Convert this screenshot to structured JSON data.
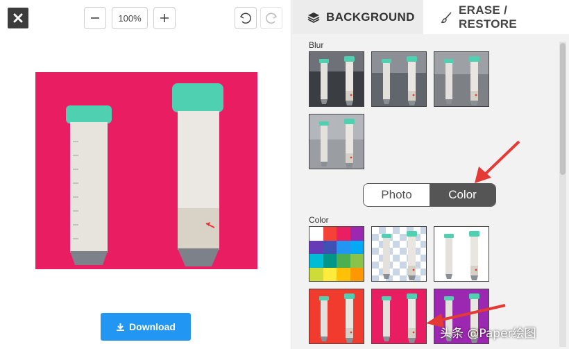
{
  "toolbar": {
    "zoom": "100%"
  },
  "download_label": "Download",
  "tabs": {
    "background": "BACKGROUND",
    "erase_restore": "ERASE / RESTORE"
  },
  "blur_label": "Blur",
  "toggle": {
    "photo": "Photo",
    "color": "Color"
  },
  "color_label": "Color",
  "watermark": "头条 @Paper绘图",
  "colors": {
    "canvas_bg": "#e91e62",
    "download": "#2196f3",
    "cap": "#4fd0b0",
    "arrow": "#e53935"
  },
  "swatches": [
    "#ffffff",
    "#f44336",
    "#e91e63",
    "#9c27b0",
    "#673ab7",
    "#3f51b5",
    "#2196f3",
    "#03a9f4",
    "#00bcd4",
    "#009688",
    "#4caf50",
    "#8bc34a",
    "#cddc39",
    "#ffeb3b",
    "#ffc107",
    "#ff9800"
  ]
}
